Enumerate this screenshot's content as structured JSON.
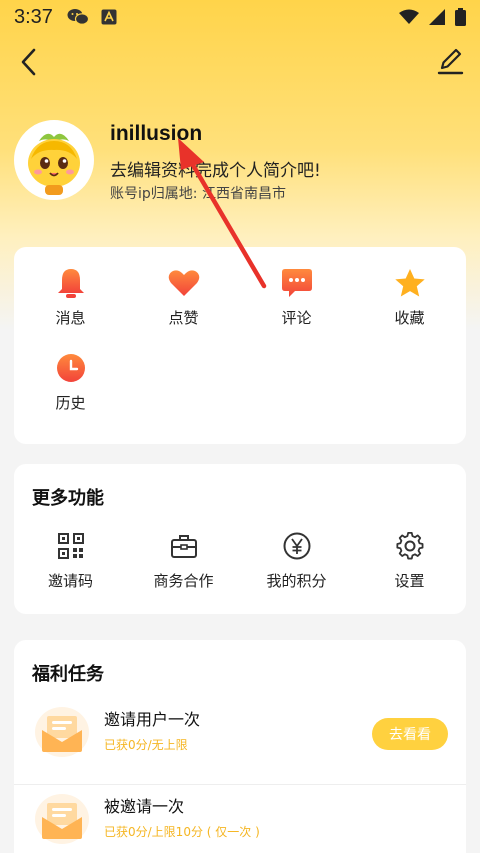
{
  "status_bar": {
    "time": "3:37"
  },
  "profile": {
    "username": "inillusion",
    "bio": "去编辑资料完成个人简介吧!",
    "ip_location": "账号ip归属地: 江西省南昌市"
  },
  "actions": [
    {
      "label": "消息",
      "icon": "bell-icon",
      "color": "#f4553b"
    },
    {
      "label": "点赞",
      "icon": "heart-icon",
      "color": "#f4553b"
    },
    {
      "label": "评论",
      "icon": "comment-icon",
      "color": "#f4553b"
    },
    {
      "label": "收藏",
      "icon": "star-icon",
      "color": "#ffb01f"
    },
    {
      "label": "历史",
      "icon": "clock-icon",
      "color": "#f4553b"
    }
  ],
  "more": {
    "title": "更多功能",
    "items": [
      {
        "label": "邀请码",
        "icon": "qrcode-icon"
      },
      {
        "label": "商务合作",
        "icon": "briefcase-icon"
      },
      {
        "label": "我的积分",
        "icon": "yen-coin-icon"
      },
      {
        "label": "设置",
        "icon": "gear-icon"
      }
    ]
  },
  "tasks": {
    "title": "福利任务",
    "items": [
      {
        "title": "邀请用户一次",
        "subtitle": "已获0分/无上限",
        "button": "去看看"
      },
      {
        "title": "被邀请一次",
        "subtitle": "已获0分/上限10分 ( 仅一次 )"
      }
    ]
  },
  "colors": {
    "accent_yellow": "#ffd13f",
    "accent_red": "#f4553b",
    "annotation_arrow": "#e8322a"
  }
}
